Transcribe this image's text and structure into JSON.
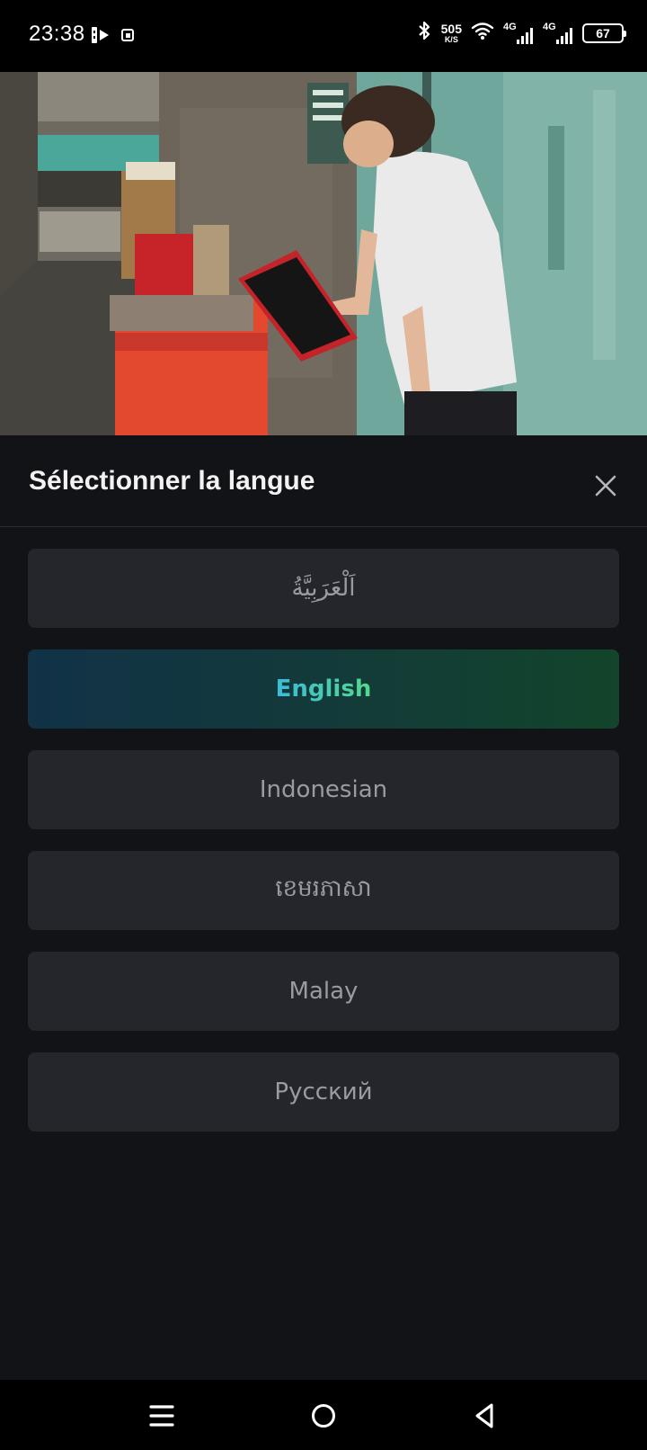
{
  "status_bar": {
    "time": "23:38",
    "net_speed_value": "505",
    "net_speed_unit": "K/S",
    "sim1_label": "4G",
    "sim2_label": "4G",
    "battery_level": "67"
  },
  "sheet": {
    "title": "Sélectionner la langue",
    "selected_language": "English",
    "languages": [
      {
        "label": "اَلْعَرَبِيَّةُ"
      },
      {
        "label": "English"
      },
      {
        "label": "Indonesian"
      },
      {
        "label": "ខេមរភាសា"
      },
      {
        "label": "Malay"
      },
      {
        "label": "Русский"
      }
    ]
  },
  "colors": {
    "sheet_background": "#121316",
    "item_background": "#25262b",
    "item_text": "#9a9ba0",
    "accent_start": "#3bbcd9",
    "accent_end": "#54d88e"
  },
  "icons": {
    "close": "close-icon",
    "nav_menu": "menu-icon",
    "nav_home": "home-icon",
    "nav_back": "back-icon"
  }
}
